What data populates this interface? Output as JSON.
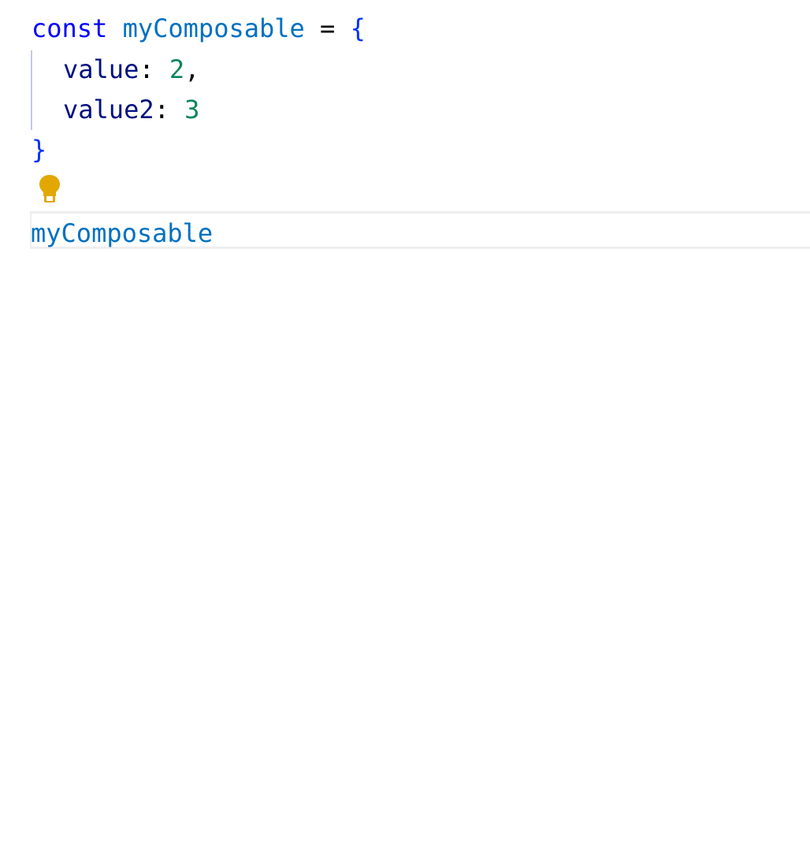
{
  "editor": {
    "line1": {
      "keyword": "const",
      "identifier": "myComposable",
      "operator": "=",
      "open_brace": "{"
    },
    "line2": {
      "property": "value",
      "colon": ":",
      "number": "2",
      "comma": ","
    },
    "line3": {
      "property": "value2",
      "colon": ":",
      "number": "3"
    },
    "line4": {
      "close_brace": "}"
    },
    "line6": {
      "identifier": "myComposable"
    },
    "icons": {
      "lightbulb": "lightbulb-icon"
    },
    "colors": {
      "keyword": "#0000ff",
      "identifier": "#0070c1",
      "property": "#001080",
      "number": "#098658",
      "brace": "#0431fa",
      "lightbulb": "#e2a800",
      "background": "#ffffff"
    }
  }
}
